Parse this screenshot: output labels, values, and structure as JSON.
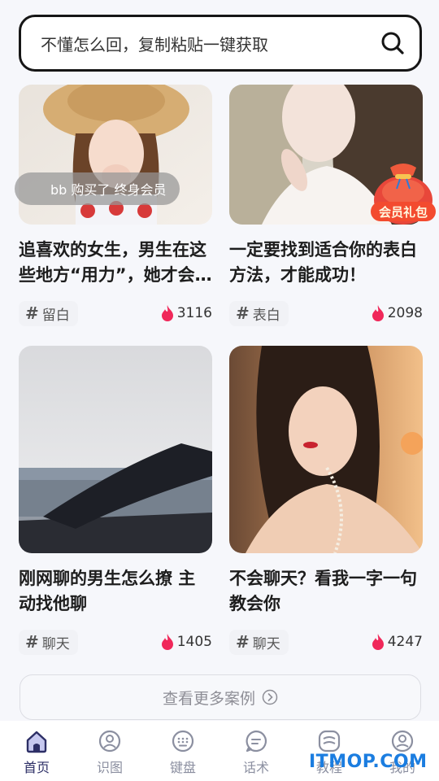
{
  "search": {
    "text": "不懂怎么回，复制粘贴一键获取"
  },
  "toast": {
    "text": "bb 购买了 终身会员"
  },
  "gift": {
    "label": "会员礼包"
  },
  "cards": [
    {
      "title": "追喜欢的女生，男生在这些地方“用力”，她才会…",
      "tag": "留白",
      "likes": "3116"
    },
    {
      "title": "一定要找到适合你的表白方法，才能成功！",
      "tag": "表白",
      "likes": "2098"
    },
    {
      "title": "刚网聊的男生怎么撩 主动找他聊",
      "tag": "聊天",
      "likes": "1405"
    },
    {
      "title": "不会聊天？看我一字一句教会你",
      "tag": "聊天",
      "likes": "4247"
    }
  ],
  "more_button": "查看更多案例",
  "tabs": [
    {
      "label": "首页",
      "icon": "home-icon"
    },
    {
      "label": "识图",
      "icon": "image-recognize-icon"
    },
    {
      "label": "键盘",
      "icon": "keyboard-icon"
    },
    {
      "label": "话术",
      "icon": "chat-script-icon"
    },
    {
      "label": "教程",
      "icon": "tutorial-icon"
    },
    {
      "label": "我的",
      "icon": "profile-icon"
    }
  ],
  "watermark": "ITMOP.COM",
  "colors": {
    "accent": "#2d2f66",
    "flame": "#f0285a",
    "gift": "#e8473a"
  }
}
